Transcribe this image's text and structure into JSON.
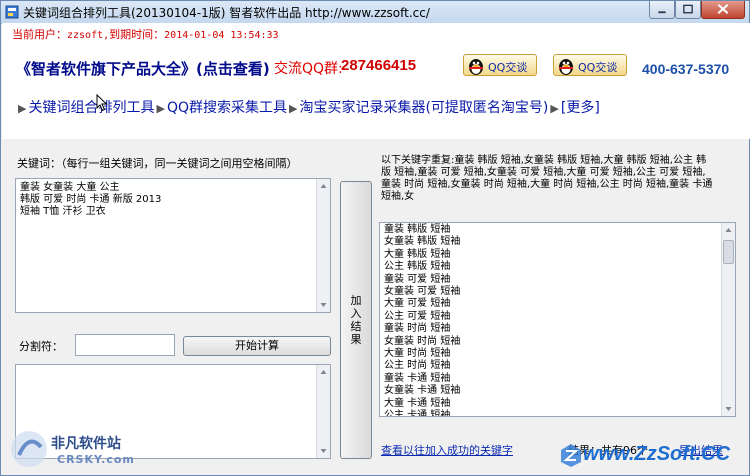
{
  "window": {
    "title": "关键词组合排列工具(20130104-1版) 智者软件出品 http://www.zzsoft.cc/"
  },
  "header": {
    "user_label": "当前用户：",
    "user_value": "zzsoft,",
    "expire_label": "到期时间：",
    "expire_value": "2014-01-04 13:54:33",
    "promo": "《智者软件旗下产品大全》(点击查看)",
    "qq_group_label": "交流QQ群:",
    "qq_group_number": "287466415",
    "qq_button_1": "QQ交谈",
    "qq_button_2": "QQ交谈",
    "phone": "400-637-5370"
  },
  "nav": {
    "items": [
      "关键词组合排列工具",
      "QQ群搜索采集工具",
      "淘宝买家记录采集器(可提取匿名淘宝号)",
      "[更多]"
    ]
  },
  "left": {
    "keyword_label": "关键词：（每行一组关键词，同一关键词之间用空格间隔）",
    "keywords": "童装 女童装 大童 公主\n韩版 可爱 时尚 卡通 新版 2013\n短袖 T恤 汗衫 卫衣",
    "split_label": "分割符：",
    "split_value": "",
    "start_button": "开始计算",
    "result_text": ""
  },
  "middle": {
    "add_button": "加\n入\n结\n果"
  },
  "right": {
    "repeat_text": "以下关键字重复:童装 韩版 短袖,女童装 韩版 短袖,大童 韩版 短袖,公主 韩版 短袖,童装 可爱 短袖,女童装 可爱 短袖,大童 可爱 短袖,公主 可爱 短袖,童装 时尚 短袖,女童装 时尚 短袖,大童 时尚 短袖,公主 时尚 短袖,童装 卡通 短袖,女",
    "results": [
      "童装 韩版 短袖",
      "女童装 韩版 短袖",
      "大童 韩版 短袖",
      "公主 韩版 短袖",
      "童装 可爱 短袖",
      "女童装 可爱 短袖",
      "大童 可爱 短袖",
      "公主 可爱 短袖",
      "童装 时尚 短袖",
      "女童装 时尚 短袖",
      "大童 时尚 短袖",
      "公主 时尚 短袖",
      "童装 卡通 短袖",
      "女童装 卡通 短袖",
      "大童 卡通 短袖",
      "公主 卡通 短袖"
    ],
    "view_added_link": "查看以往加入成功的关键字",
    "result_count": "结果：共有96个",
    "export_link": "导出结果"
  },
  "watermarks": {
    "left_text": "非凡软件站",
    "left_sub": "CRSKY.com",
    "right_text": "www.ZzSoft.CC"
  },
  "colors": {
    "title_bar": "#c4d8ef",
    "user_line": "#d40000",
    "promo": "#000a8a",
    "link": "#0a2ab0",
    "phone": "#1c4fa8"
  }
}
